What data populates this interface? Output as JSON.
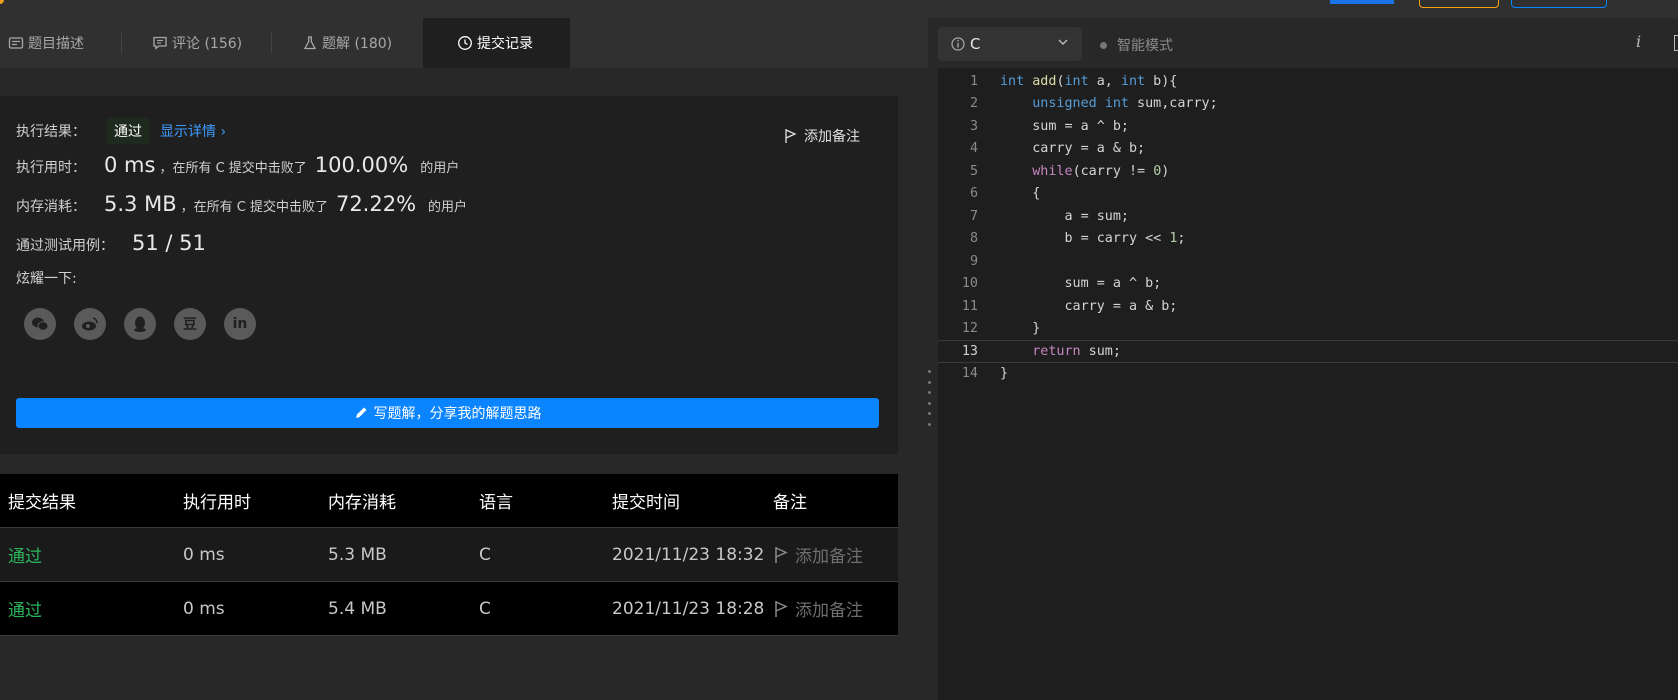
{
  "tabs": [
    {
      "label": "题目描述",
      "icon": "description-icon"
    },
    {
      "label": "评论 (156)",
      "icon": "comment-icon"
    },
    {
      "label": "题解 (180)",
      "icon": "flask-icon"
    },
    {
      "label": "提交记录",
      "icon": "clock-icon"
    }
  ],
  "result": {
    "status_label": "执行结果：",
    "status": "通过",
    "detail_link": "显示详情 ›",
    "add_note": "添加备注",
    "runtime_label": "执行用时：",
    "runtime_value": "0 ms",
    "runtime_mid": "，在所有 C 提交中击败了",
    "runtime_pct": "100.00%",
    "runtime_tail": "的用户",
    "memory_label": "内存消耗：",
    "memory_value": "5.3 MB",
    "memory_mid": "，在所有 C 提交中击败了",
    "memory_pct": "72.22%",
    "memory_tail": "的用户",
    "tests_label": "通过测试用例：",
    "tests_value": "51 / 51",
    "share_label": "炫耀一下:",
    "share_icons": [
      "wechat-icon",
      "weibo-icon",
      "qq-icon",
      "douban-icon",
      "linkedin-icon"
    ],
    "douban_glyph": "豆",
    "linkedin_glyph": "in",
    "write_button": "写题解，分享我的解题思路"
  },
  "submissions": {
    "headers": [
      "提交结果",
      "执行用时",
      "内存消耗",
      "语言",
      "提交时间",
      "备注"
    ],
    "rows": [
      {
        "result": "通过",
        "runtime": "0 ms",
        "memory": "5.3 MB",
        "lang": "C",
        "time": "2021/11/23 18:32",
        "note": "添加备注"
      },
      {
        "result": "通过",
        "runtime": "0 ms",
        "memory": "5.4 MB",
        "lang": "C",
        "time": "2021/11/23 18:28",
        "note": "添加备注"
      }
    ]
  },
  "editor": {
    "language": "C",
    "mode": "智能模式",
    "info": "i",
    "current_line": 13,
    "lines": [
      "int add(int a, int b){",
      "    unsigned int sum,carry;",
      "    sum = a ^ b;",
      "    carry = a & b;",
      "    while(carry != 0)",
      "    {",
      "        a = sum;",
      "        b = carry << 1;",
      "",
      "        sum = a ^ b;",
      "        carry = a & b;",
      "    }",
      "    return sum;",
      "}"
    ]
  },
  "colors": {
    "accent": "#0a84ff",
    "pass": "#2db55d",
    "link": "#3e9bff"
  }
}
